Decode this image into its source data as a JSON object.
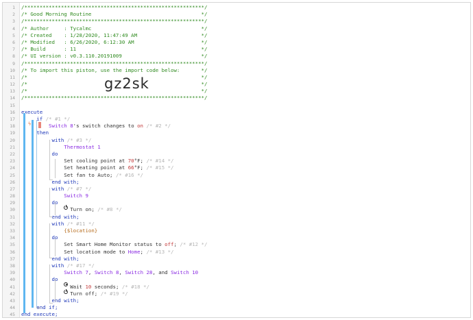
{
  "editor": {
    "lines": [
      {
        "n": "1",
        "tokens": [
          {
            "t": "/***********************************************************/",
            "c": "comment"
          }
        ]
      },
      {
        "n": "2",
        "tokens": [
          {
            "t": "/* Good Morning Routine                                    */",
            "c": "comment"
          }
        ]
      },
      {
        "n": "3",
        "tokens": [
          {
            "t": "/***********************************************************/",
            "c": "comment"
          }
        ]
      },
      {
        "n": "4",
        "tokens": [
          {
            "t": "/* Author     : Tycalmc                                    */",
            "c": "comment"
          }
        ]
      },
      {
        "n": "5",
        "tokens": [
          {
            "t": "/* Created    : 1/28/2020, 11:47:49 AM                     */",
            "c": "comment"
          }
        ]
      },
      {
        "n": "6",
        "tokens": [
          {
            "t": "/* Modified   : 6/26/2020, 6:12:30 AM                      */",
            "c": "comment"
          }
        ]
      },
      {
        "n": "7",
        "tokens": [
          {
            "t": "/* Build      : 11                                         */",
            "c": "comment"
          }
        ]
      },
      {
        "n": "8",
        "tokens": [
          {
            "t": "/* UI version : v0.3.110.20191009                          */",
            "c": "comment"
          }
        ]
      },
      {
        "n": "9",
        "tokens": [
          {
            "t": "/***********************************************************/",
            "c": "comment"
          }
        ]
      },
      {
        "n": "10",
        "tokens": [
          {
            "t": "/* To import this piston, use the import code below:       */",
            "c": "comment"
          }
        ]
      },
      {
        "n": "11",
        "tokens": [
          {
            "t": "/*                                                         */",
            "c": "comment"
          }
        ]
      },
      {
        "n": "12",
        "tokens": [
          {
            "t": "/*                                                         */",
            "c": "comment"
          }
        ]
      },
      {
        "n": "13",
        "tokens": [
          {
            "t": "/*                                                         */",
            "c": "comment"
          }
        ]
      },
      {
        "n": "14",
        "tokens": [
          {
            "t": "/***********************************************************/",
            "c": "comment"
          }
        ]
      },
      {
        "n": "15",
        "tokens": []
      },
      {
        "n": "16",
        "tokens": [
          {
            "t": "execute",
            "c": "kw"
          }
        ]
      },
      {
        "n": "17",
        "tokens": [
          {
            "t": "     ",
            "c": "plain"
          },
          {
            "t": "if",
            "c": "kw"
          },
          {
            "t": " /* #1 */",
            "c": "dim"
          }
        ]
      },
      {
        "n": "18",
        "tokens": [
          {
            "t": "         ",
            "c": "plain"
          },
          {
            "t": "Switch 8",
            "c": "dev"
          },
          {
            "t": "'s switch changes to ",
            "c": "plain"
          },
          {
            "t": "on",
            "c": "val"
          },
          {
            "t": " /* #2 */",
            "c": "dim"
          }
        ]
      },
      {
        "n": "19",
        "tokens": [
          {
            "t": "     ",
            "c": "plain"
          },
          {
            "t": "then",
            "c": "kw"
          }
        ]
      },
      {
        "n": "20",
        "tokens": [
          {
            "t": "          ",
            "c": "plain"
          },
          {
            "t": "with",
            "c": "kw"
          },
          {
            "t": " /* #3 */",
            "c": "dim"
          }
        ]
      },
      {
        "n": "21",
        "tokens": [
          {
            "t": "              ",
            "c": "plain"
          },
          {
            "t": "Thermostat 1",
            "c": "dev"
          }
        ]
      },
      {
        "n": "22",
        "tokens": [
          {
            "t": "          ",
            "c": "plain"
          },
          {
            "t": "do",
            "c": "kw"
          }
        ]
      },
      {
        "n": "23",
        "tokens": [
          {
            "t": "              Set cooling point at ",
            "c": "plain"
          },
          {
            "t": "70",
            "c": "val"
          },
          {
            "t": "°F; ",
            "c": "plain"
          },
          {
            "t": "/* #14 */",
            "c": "dim"
          }
        ]
      },
      {
        "n": "24",
        "tokens": [
          {
            "t": "              Set heating point at ",
            "c": "plain"
          },
          {
            "t": "66",
            "c": "val"
          },
          {
            "t": "°F; ",
            "c": "plain"
          },
          {
            "t": "/* #15 */",
            "c": "dim"
          }
        ]
      },
      {
        "n": "25",
        "tokens": [
          {
            "t": "              Set fan to Auto; ",
            "c": "plain"
          },
          {
            "t": "/* #16 */",
            "c": "dim"
          }
        ]
      },
      {
        "n": "26",
        "tokens": [
          {
            "t": "          ",
            "c": "plain"
          },
          {
            "t": "end with;",
            "c": "kw"
          }
        ]
      },
      {
        "n": "27",
        "tokens": [
          {
            "t": "          ",
            "c": "plain"
          },
          {
            "t": "with",
            "c": "kw"
          },
          {
            "t": " /* #7 */",
            "c": "dim"
          }
        ]
      },
      {
        "n": "28",
        "tokens": [
          {
            "t": "              ",
            "c": "plain"
          },
          {
            "t": "Switch 9",
            "c": "dev"
          }
        ]
      },
      {
        "n": "29",
        "tokens": [
          {
            "t": "          ",
            "c": "plain"
          },
          {
            "t": "do",
            "c": "kw"
          }
        ]
      },
      {
        "n": "30",
        "tokens": [
          {
            "t": "                ",
            "c": "plain"
          },
          {
            "t": "Turn on; ",
            "c": "plain"
          },
          {
            "t": "/* #8 */",
            "c": "dim"
          }
        ]
      },
      {
        "n": "31",
        "tokens": [
          {
            "t": "          ",
            "c": "plain"
          },
          {
            "t": "end with;",
            "c": "kw"
          }
        ]
      },
      {
        "n": "32",
        "tokens": [
          {
            "t": "          ",
            "c": "plain"
          },
          {
            "t": "with",
            "c": "kw"
          },
          {
            "t": " /* #11 */",
            "c": "dim"
          }
        ]
      },
      {
        "n": "33",
        "tokens": [
          {
            "t": "              ",
            "c": "plain"
          },
          {
            "t": "{$location}",
            "c": "var"
          }
        ]
      },
      {
        "n": "34",
        "tokens": [
          {
            "t": "          ",
            "c": "plain"
          },
          {
            "t": "do",
            "c": "kw"
          }
        ]
      },
      {
        "n": "35",
        "tokens": [
          {
            "t": "              Set Smart Home Monitor status to ",
            "c": "plain"
          },
          {
            "t": "off",
            "c": "val"
          },
          {
            "t": "; ",
            "c": "plain"
          },
          {
            "t": "/* #12 */",
            "c": "dim"
          }
        ]
      },
      {
        "n": "36",
        "tokens": [
          {
            "t": "              Set location mode to ",
            "c": "plain"
          },
          {
            "t": "Home",
            "c": "dev"
          },
          {
            "t": "; ",
            "c": "plain"
          },
          {
            "t": "/* #13 */",
            "c": "dim"
          }
        ]
      },
      {
        "n": "37",
        "tokens": [
          {
            "t": "          ",
            "c": "plain"
          },
          {
            "t": "end with;",
            "c": "kw"
          }
        ]
      },
      {
        "n": "38",
        "tokens": [
          {
            "t": "          ",
            "c": "plain"
          },
          {
            "t": "with",
            "c": "kw"
          },
          {
            "t": " /* #17 */",
            "c": "dim"
          }
        ]
      },
      {
        "n": "39",
        "tokens": [
          {
            "t": "              ",
            "c": "plain"
          },
          {
            "t": "Switch 7",
            "c": "dev"
          },
          {
            "t": ", ",
            "c": "plain"
          },
          {
            "t": "Switch 8",
            "c": "dev"
          },
          {
            "t": ", ",
            "c": "plain"
          },
          {
            "t": "Switch 28",
            "c": "dev"
          },
          {
            "t": ", and ",
            "c": "plain"
          },
          {
            "t": "Switch 10",
            "c": "dev"
          }
        ]
      },
      {
        "n": "40",
        "tokens": [
          {
            "t": "          ",
            "c": "plain"
          },
          {
            "t": "do",
            "c": "kw"
          }
        ]
      },
      {
        "n": "41",
        "tokens": [
          {
            "t": "                ",
            "c": "plain"
          },
          {
            "t": "Wait ",
            "c": "plain"
          },
          {
            "t": "10",
            "c": "val"
          },
          {
            "t": " seconds; ",
            "c": "plain"
          },
          {
            "t": "/* #18 */",
            "c": "dim"
          }
        ]
      },
      {
        "n": "42",
        "tokens": [
          {
            "t": "                ",
            "c": "plain"
          },
          {
            "t": "Turn off; ",
            "c": "plain"
          },
          {
            "t": "/* #19 */",
            "c": "dim"
          }
        ]
      },
      {
        "n": "43",
        "tokens": [
          {
            "t": "          ",
            "c": "plain"
          },
          {
            "t": "end with;",
            "c": "kw"
          }
        ]
      },
      {
        "n": "44",
        "tokens": [
          {
            "t": "     ",
            "c": "plain"
          },
          {
            "t": "end if;",
            "c": "kw"
          }
        ]
      },
      {
        "n": "45",
        "tokens": [
          {
            "t": "end execute;",
            "c": "kw"
          }
        ]
      }
    ]
  },
  "import_code": "gz2sk",
  "icons": {
    "trigger": "lightning-bolt-icon",
    "turn_on": "power-icon",
    "wait": "clock-icon",
    "turn_off": "power-off-icon"
  },
  "colors": {
    "comment": "#2f8a1f",
    "keyword": "#1c36b8",
    "device": "#8a2be2",
    "value": "#c23838",
    "variable": "#b56a1a",
    "block_bar": "#5eb6f0",
    "condition_flag": "#e8877b"
  }
}
